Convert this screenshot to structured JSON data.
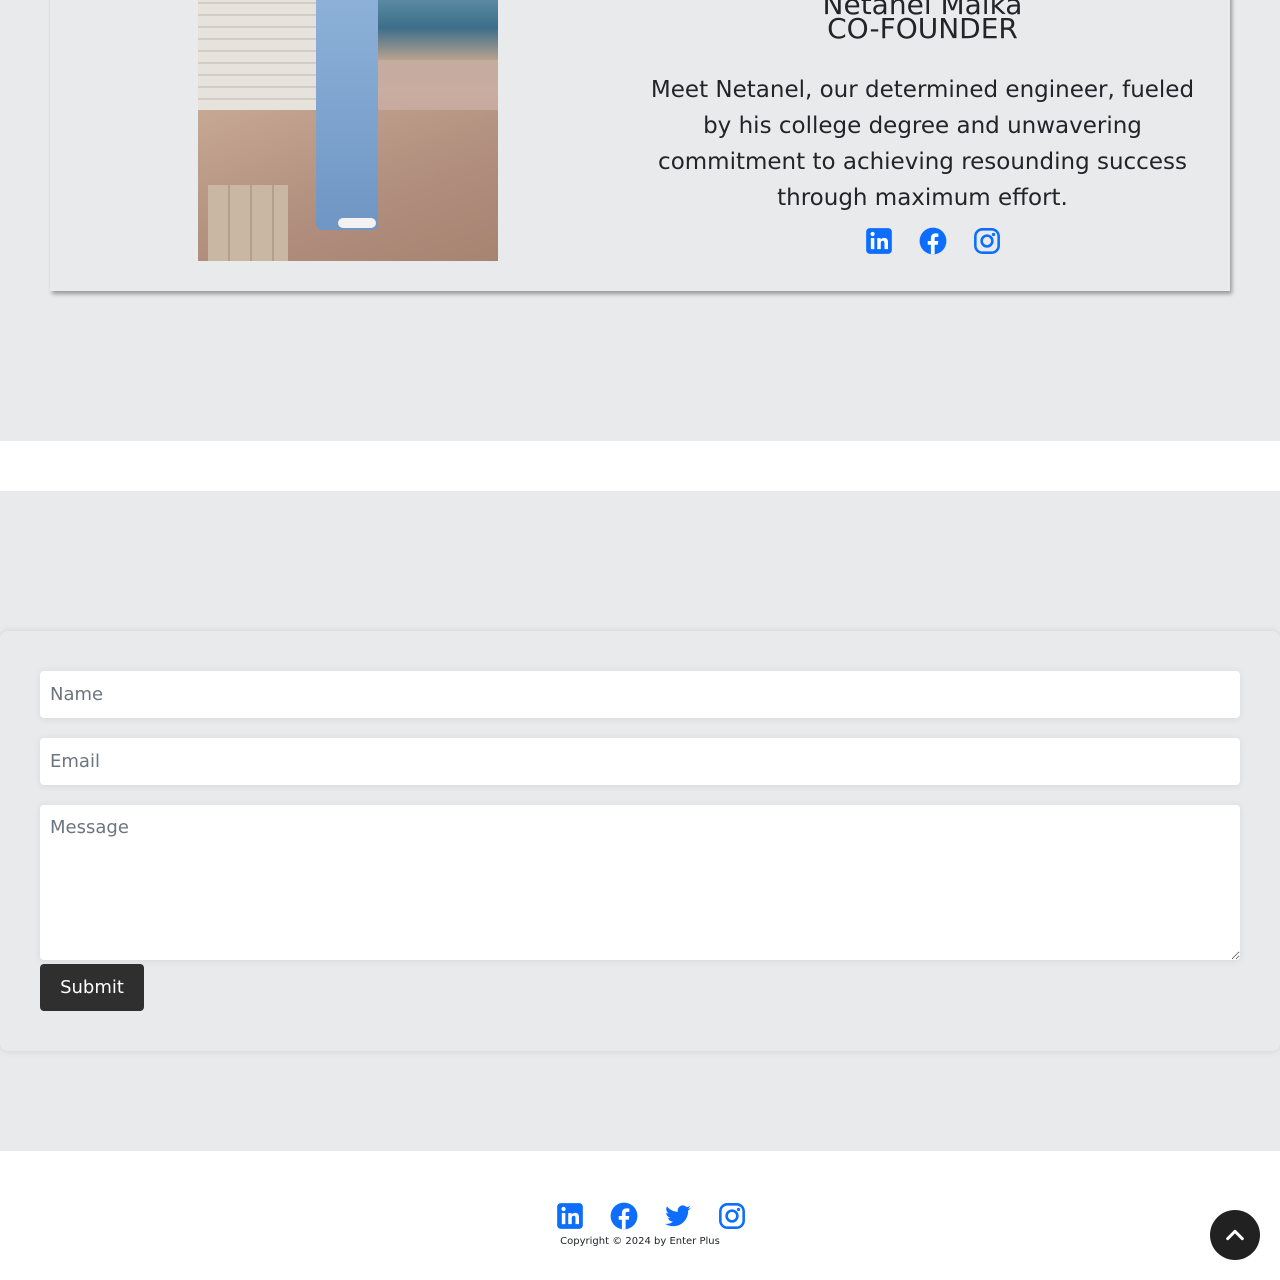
{
  "team_member": {
    "name": "Netanel Malka",
    "role": "CO-FOUNDER",
    "bio": "Meet Netanel, our determined engineer, fueled by his college degree and unwavering commitment to achieving resounding success through maximum effort.",
    "social_icons": [
      "linkedin-icon",
      "facebook-icon",
      "instagram-icon"
    ]
  },
  "contact_form": {
    "name_placeholder": "Name",
    "email_placeholder": "Email",
    "message_placeholder": "Message",
    "submit_label": "Submit"
  },
  "footer": {
    "social_icons": [
      "linkedin-icon",
      "facebook-icon",
      "twitter-icon",
      "instagram-icon"
    ],
    "copyright": "Copyright © 2024 by Enter Plus"
  },
  "scroll_top_icon": "chevron-up-icon",
  "colors": {
    "background": "#e9eaec",
    "icon_blue": "#0d6efd",
    "button_dark": "#2f2f2f",
    "text": "#212529"
  }
}
